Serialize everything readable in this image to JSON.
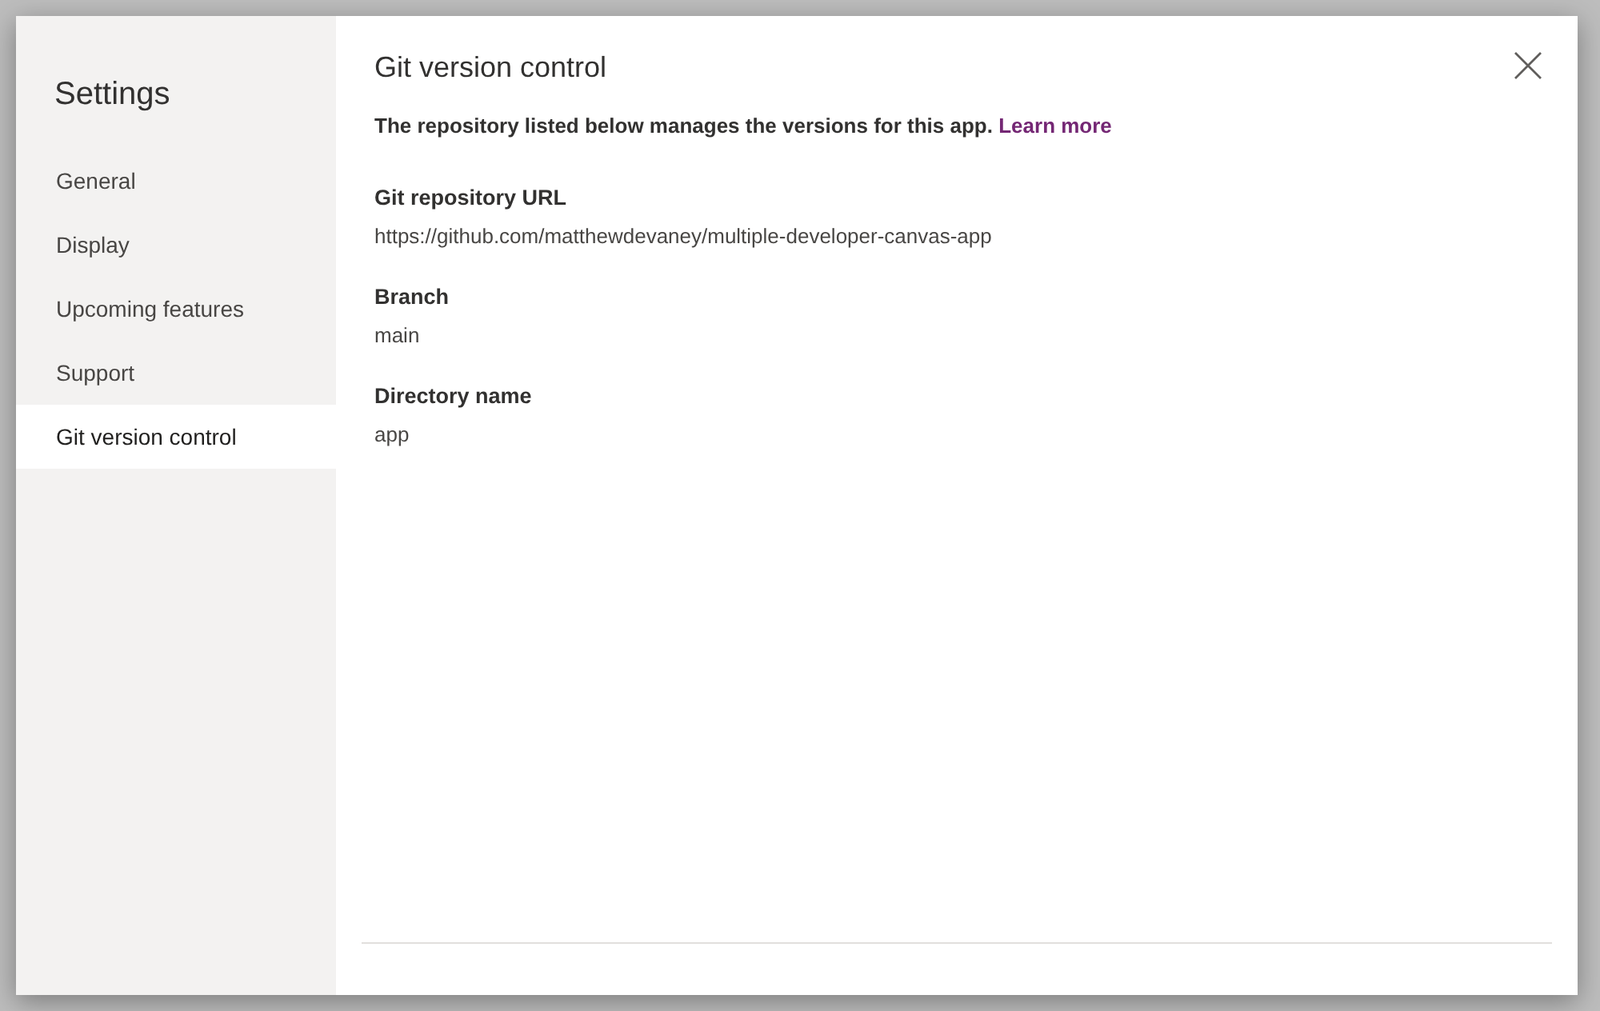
{
  "sidebar": {
    "title": "Settings",
    "items": [
      {
        "label": "General",
        "selected": false
      },
      {
        "label": "Display",
        "selected": false
      },
      {
        "label": "Upcoming features",
        "selected": false
      },
      {
        "label": "Support",
        "selected": false
      },
      {
        "label": "Git version control",
        "selected": true
      }
    ]
  },
  "panel": {
    "title": "Git version control",
    "description": "The repository listed below manages the versions for this app.",
    "link": "Learn more",
    "fields": [
      {
        "label": "Git repository URL",
        "value": "https://github.com/matthewdevaney/multiple-developer-canvas-app"
      },
      {
        "label": "Branch",
        "value": "main"
      },
      {
        "label": "Directory name",
        "value": "app"
      }
    ]
  }
}
